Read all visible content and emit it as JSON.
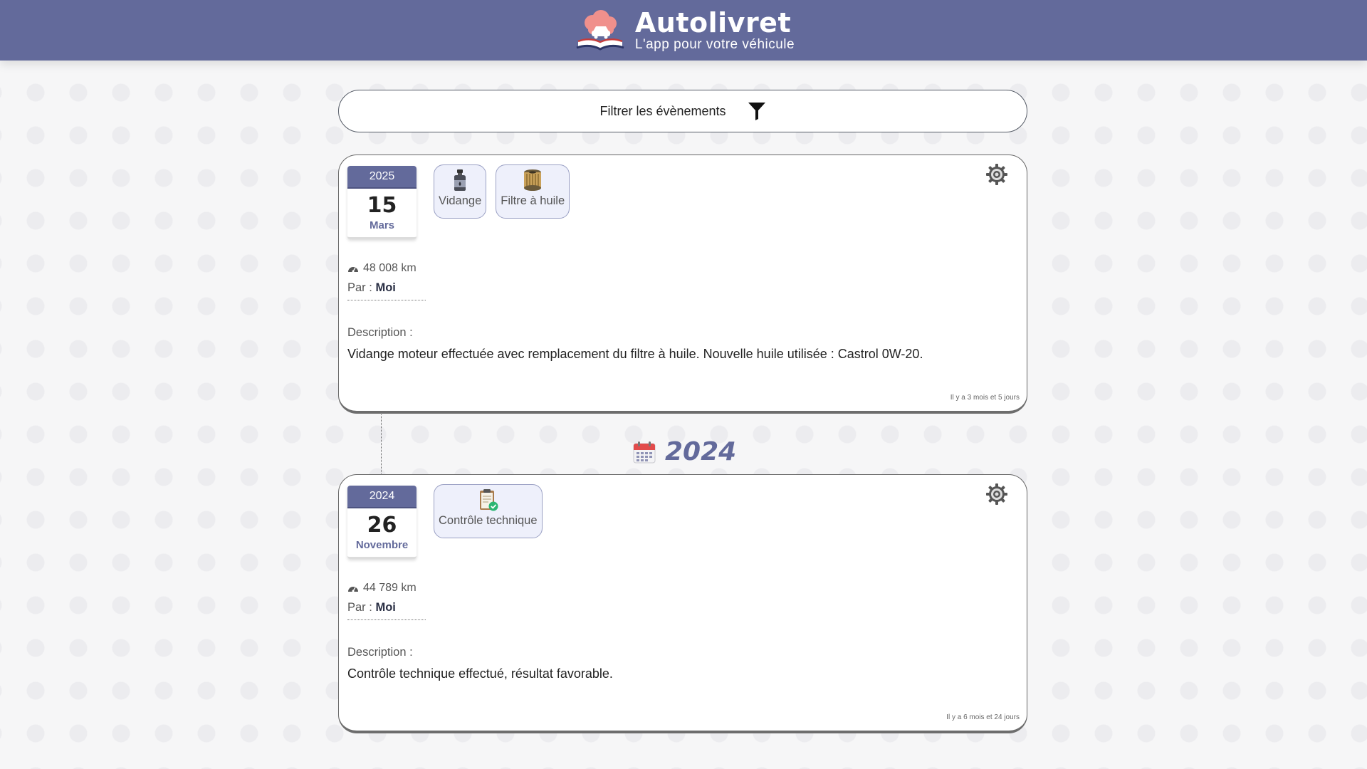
{
  "header": {
    "title": "Autolivret",
    "subtitle": "L'app pour votre véhicule",
    "logo_icon": "car-book-cloud-logo-icon"
  },
  "filter": {
    "label": "Filtrer les évènements",
    "icon": "filter-icon"
  },
  "year_separator": {
    "year": "2024",
    "icon": "calendar-icon"
  },
  "events": [
    {
      "date": {
        "year": "2025",
        "day": "15",
        "month": "Mars"
      },
      "tags": [
        {
          "label": "Vidange",
          "icon": "oil-can-icon"
        },
        {
          "label": "Filtre à huile",
          "icon": "oil-filter-icon"
        }
      ],
      "mileage": "48 008 km",
      "by_label": "Par :",
      "by_value": "Moi",
      "description_label": "Description :",
      "description": "Vidange moteur effectuée avec remplacement du filtre à huile. Nouvelle huile utilisée : Castrol 0W-20.",
      "elapsed": "Il y a 3 mois et 5 jours"
    },
    {
      "date": {
        "year": "2024",
        "day": "26",
        "month": "Novembre"
      },
      "tags": [
        {
          "label": "Contrôle technique",
          "icon": "clipboard-check-icon"
        }
      ],
      "mileage": "44 789 km",
      "by_label": "Par :",
      "by_value": "Moi",
      "description_label": "Description :",
      "description": "Contrôle technique effectué, résultat favorable.",
      "elapsed": "Il y a 6 mois et 24 jours"
    }
  ],
  "colors": {
    "primary": "#636a9b",
    "background": "#f6f6f7",
    "tag_bg": "#eef0fb"
  }
}
